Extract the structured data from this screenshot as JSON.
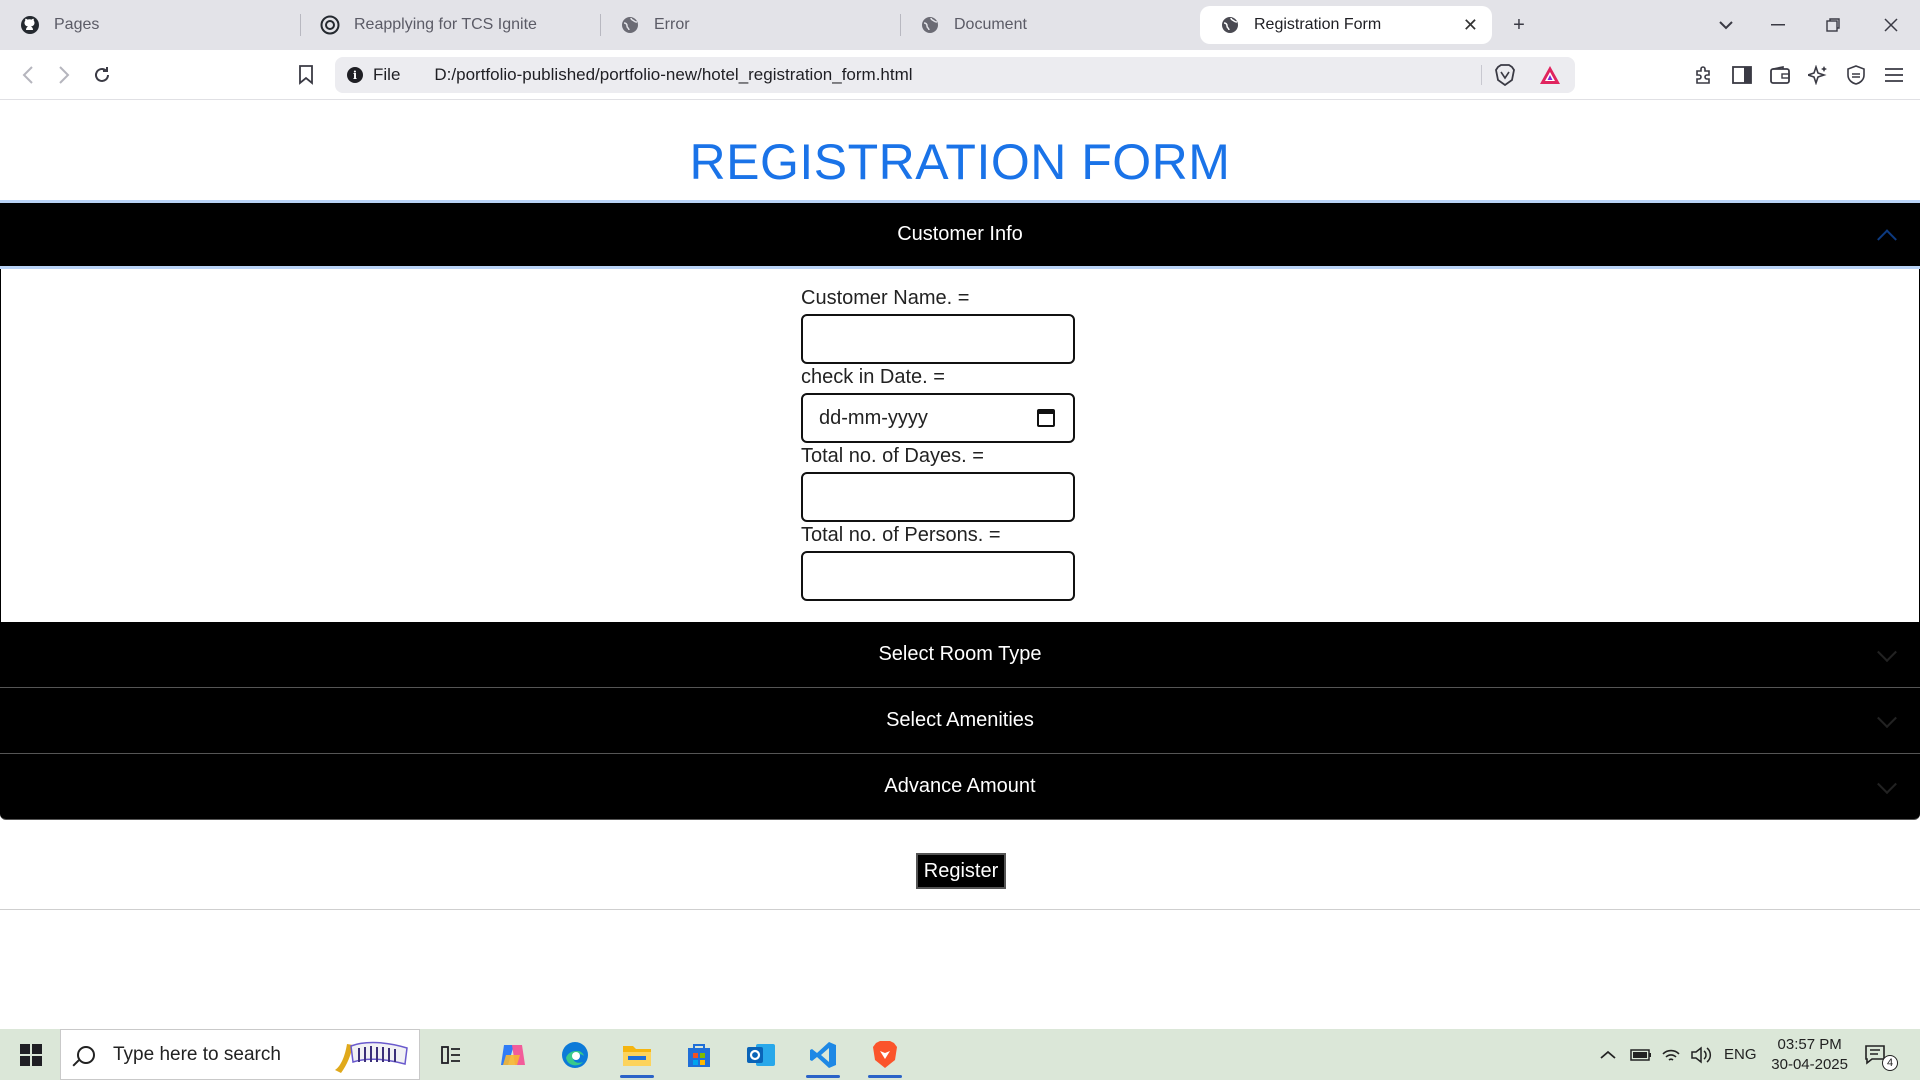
{
  "browser": {
    "tabs": [
      {
        "label": "Pages",
        "icon": "github-icon"
      },
      {
        "label": "Reapplying for TCS Ignite",
        "icon": "openai-icon"
      },
      {
        "label": "Error",
        "icon": "globe-icon"
      },
      {
        "label": "Document",
        "icon": "globe-icon"
      },
      {
        "label": "Registration Form",
        "icon": "globe-icon",
        "active": true
      }
    ],
    "url_scheme_label": "File",
    "url": "D:/portfolio-published/portfolio-new/hotel_registration_form.html"
  },
  "page": {
    "title": "REGISTRATION FORM",
    "title_color": "#1a73e8",
    "sections": [
      {
        "label": "Customer Info",
        "expanded": true
      },
      {
        "label": "Select Room Type",
        "expanded": false
      },
      {
        "label": "Select Amenities",
        "expanded": false
      },
      {
        "label": "Advance Amount",
        "expanded": false
      }
    ],
    "fields": {
      "customer_name_label": "Customer Name. =",
      "customer_name_value": "",
      "checkin_label": "check in Date. =",
      "checkin_placeholder": "dd-mm-yyyy",
      "days_label": "Total no. of Dayes. =",
      "days_value": "",
      "persons_label": "Total no. of Persons. =",
      "persons_value": ""
    },
    "register_label": "Register"
  },
  "taskbar": {
    "search_placeholder": "Type here to search",
    "language": "ENG",
    "time": "03:57 PM",
    "date": "30-04-2025",
    "notification_count": "4"
  }
}
